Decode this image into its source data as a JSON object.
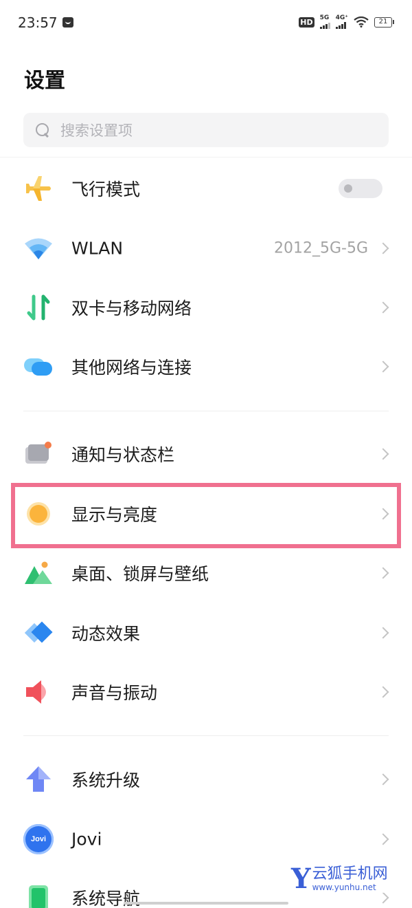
{
  "status_bar": {
    "time": "23:57",
    "hd_badge": "HD",
    "sim1_label": "5G",
    "sim2_label": "4G⁺",
    "battery": "21"
  },
  "page_title": "设置",
  "search": {
    "placeholder": "搜索设置项"
  },
  "items": [
    {
      "label": "飞行模式",
      "icon": "airplane-icon",
      "toggle_on": false
    },
    {
      "label": "WLAN",
      "icon": "wifi-icon",
      "value": "2012_5G-5G"
    },
    {
      "label": "双卡与移动网络",
      "icon": "dual-sim-network-icon"
    },
    {
      "label": "其他网络与连接",
      "icon": "connection-icon"
    },
    {
      "label": "通知与状态栏",
      "icon": "notification-icon"
    },
    {
      "label": "显示与亮度",
      "icon": "brightness-icon",
      "highlighted": true
    },
    {
      "label": "桌面、锁屏与壁纸",
      "icon": "wallpaper-icon"
    },
    {
      "label": "动态效果",
      "icon": "motion-effect-icon"
    },
    {
      "label": "声音与振动",
      "icon": "sound-icon"
    },
    {
      "label": "系统升级",
      "icon": "system-upgrade-icon"
    },
    {
      "label": "Jovi",
      "icon": "jovi-icon",
      "icon_text": "Jovi"
    },
    {
      "label": "系统导航",
      "icon": "system-navigation-icon"
    }
  ],
  "colors": {
    "highlight_border": "#f0708f",
    "airplane": "#f7c24a",
    "wifi": "#3b9df0",
    "brightness": "#fbb43c",
    "watermark": "#3a5fd6"
  },
  "watermark": {
    "logo": "Y",
    "name": "云狐手机网",
    "url": "www.yunhu.net"
  }
}
